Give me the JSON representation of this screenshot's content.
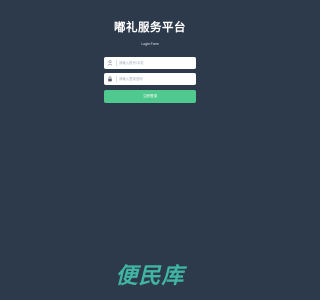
{
  "header": {
    "title": "嘟礼服务平台",
    "subtitle": "Login Form"
  },
  "form": {
    "username": {
      "icon": "user-icon",
      "placeholder": "请输入账号/手机"
    },
    "password": {
      "icon": "lock-icon",
      "placeholder": "请输入登录密码"
    },
    "login_label": "立即登录"
  },
  "watermark": {
    "text": "便民库"
  },
  "colors": {
    "background": "#2d3a4b",
    "button": "#50c98e",
    "watermark": "#40b6a2"
  }
}
